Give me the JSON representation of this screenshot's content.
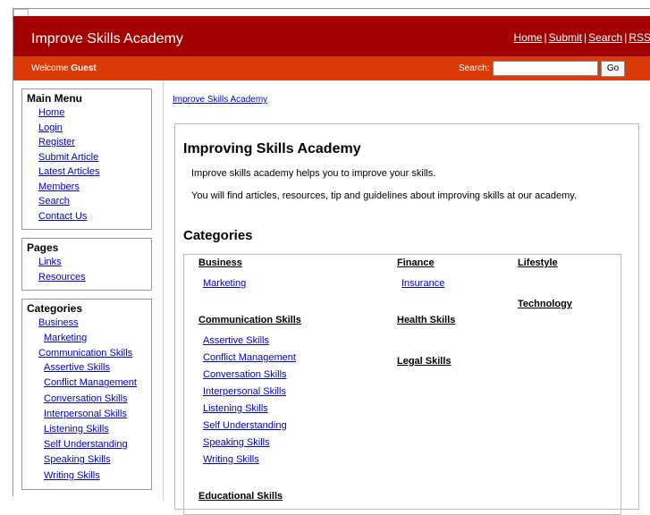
{
  "header": {
    "site_title": "Improve Skills Academy",
    "links": [
      "Home",
      "Submit",
      "Search",
      "RSS"
    ],
    "separator": "|"
  },
  "subbar": {
    "welcome_text": "Welcome",
    "welcome_user": "Guest",
    "search_label": "Search:",
    "search_value": "",
    "go_label": "Go"
  },
  "sidebar": {
    "main_menu": {
      "title": "Main Menu",
      "items": [
        "Home",
        "Login",
        "Register",
        "Submit Article",
        "Latest Articles",
        "Members",
        "Search",
        "Contact Us"
      ]
    },
    "pages": {
      "title": "Pages",
      "items": [
        "Links",
        "Resources"
      ]
    },
    "categories": {
      "title": "Categories",
      "items": [
        {
          "label": "Business",
          "sub": false
        },
        {
          "label": "Marketing",
          "sub": true
        },
        {
          "label": "Communication Skills",
          "sub": false
        },
        {
          "label": "Assertive Skills",
          "sub": true
        },
        {
          "label": "Conflict Management",
          "sub": true
        },
        {
          "label": "Conversation Skills",
          "sub": true
        },
        {
          "label": "Interpersonal Skills",
          "sub": true
        },
        {
          "label": "Listening Skills",
          "sub": true
        },
        {
          "label": "Self Understanding",
          "sub": true
        },
        {
          "label": "Speaking Skills",
          "sub": true
        },
        {
          "label": "Writing Skills",
          "sub": true
        }
      ]
    }
  },
  "breadcrumb": "Improve Skills Academy",
  "main": {
    "title": "Improving Skills Academy",
    "intro1": "Improve skills academy helps you to improve your skills.",
    "intro2": "You will find articles, resources, tip and guidelines about improving skills at our academy.",
    "categories_title": "Categories",
    "columns": [
      {
        "groups": [
          {
            "heading": "Business",
            "items": [
              "Marketing"
            ]
          },
          {
            "heading": "Communication Skills",
            "items": [
              "Assertive Skills",
              "Conflict Management",
              "Conversation Skills",
              "Interpersonal Skills",
              "Listening Skills",
              "Self Understanding",
              "Speaking Skills",
              "Writing Skills"
            ]
          },
          {
            "heading": "Educational Skills",
            "items": []
          }
        ]
      },
      {
        "groups": [
          {
            "heading": "Finance",
            "items": [
              "Insurance"
            ]
          },
          {
            "heading": "Health Skills",
            "items": []
          },
          {
            "heading": "Legal Skills",
            "items": []
          }
        ]
      },
      {
        "groups": [
          {
            "heading": "Lifestyle",
            "items": []
          },
          {
            "heading": "Technology",
            "items": []
          }
        ]
      }
    ]
  }
}
